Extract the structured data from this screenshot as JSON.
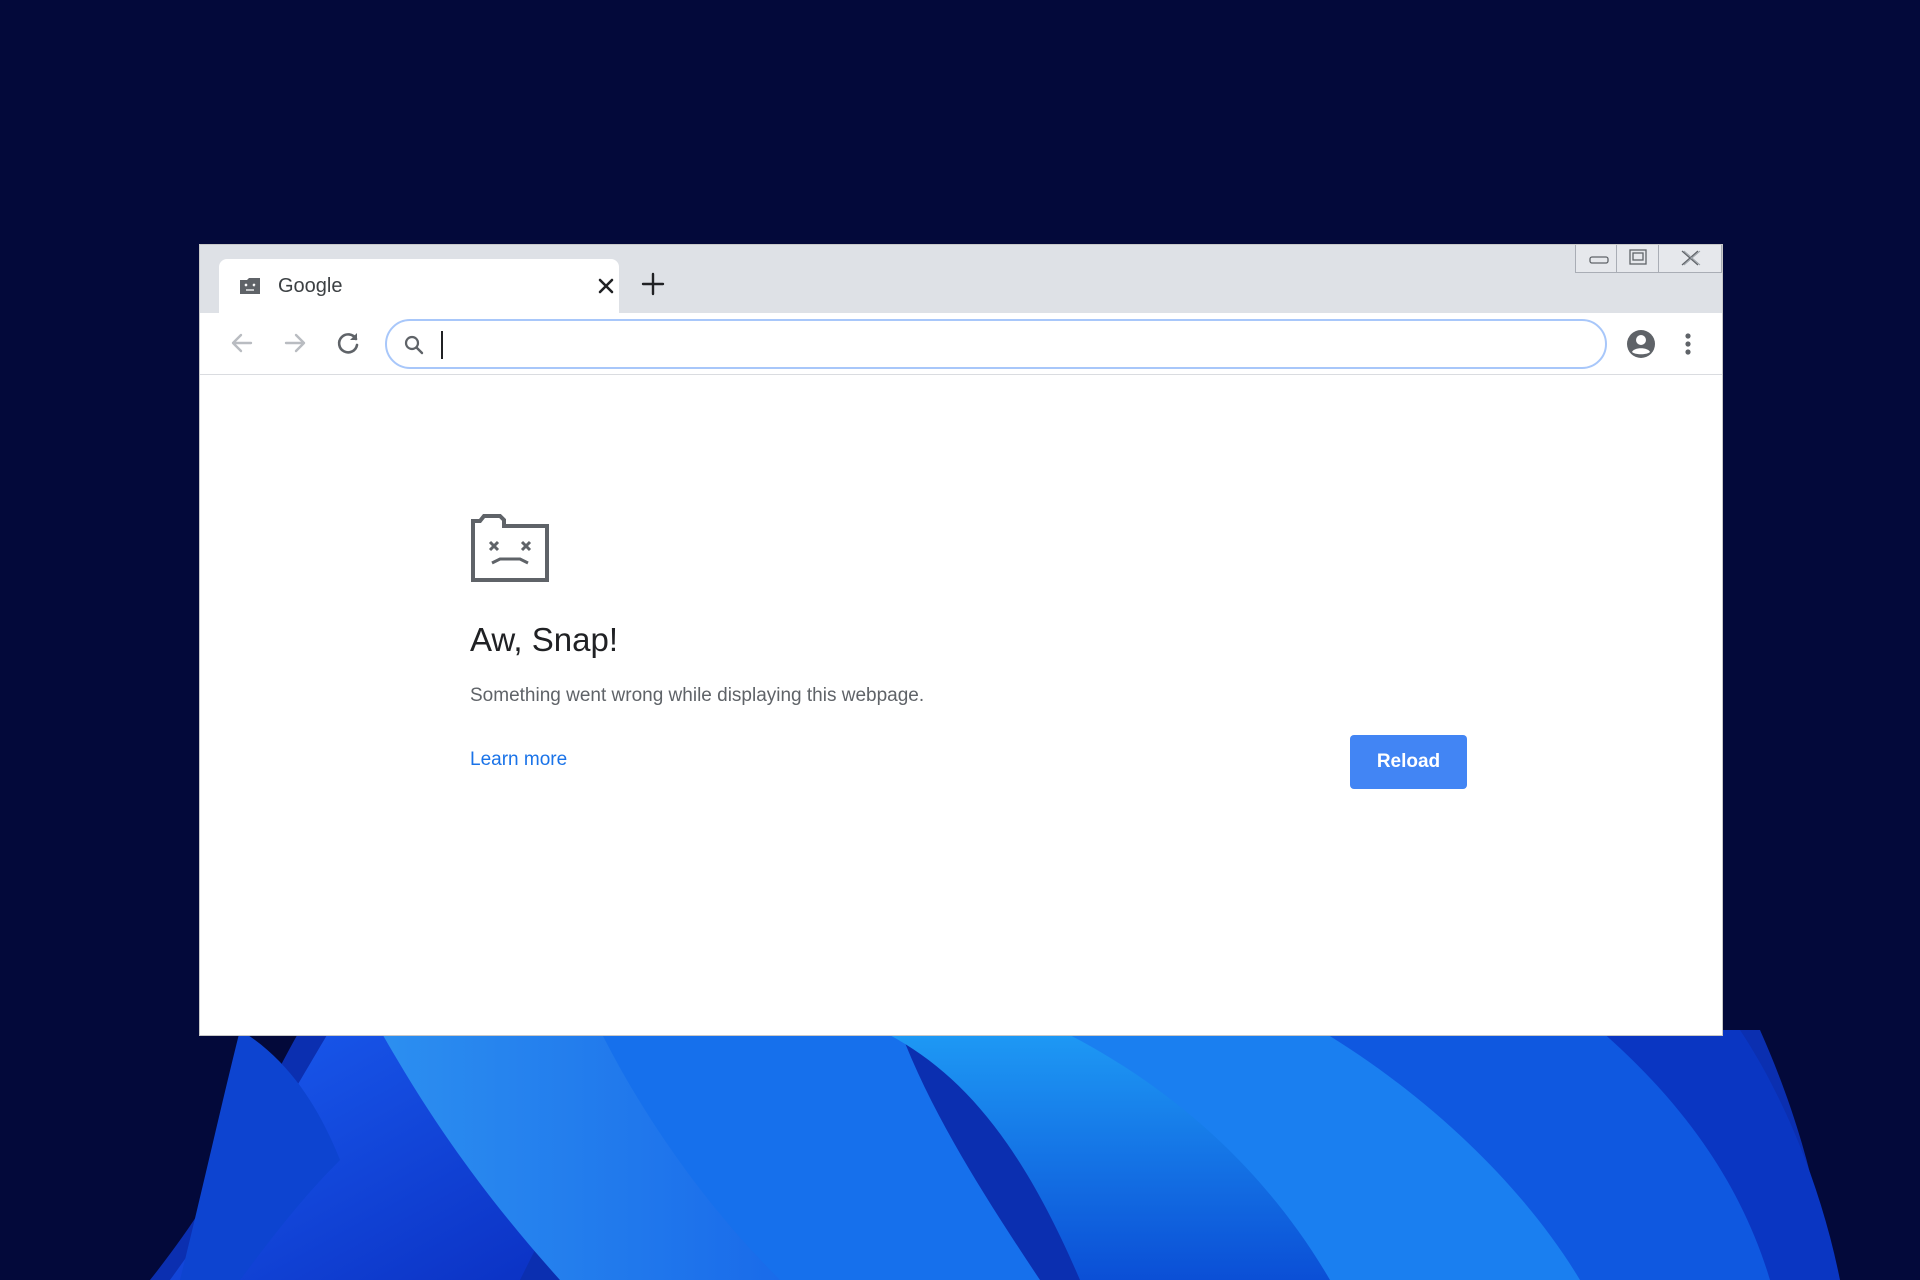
{
  "browser": {
    "tab": {
      "title": "Google",
      "favicon": "sad-folder-icon"
    },
    "omnibox": {
      "value": "",
      "placeholder": ""
    },
    "icons": {
      "back": "arrow-left-icon",
      "forward": "arrow-right-icon",
      "reload": "reload-icon",
      "search": "search-icon",
      "account": "account-circle-icon",
      "menu": "kebab-menu-icon",
      "new_tab": "plus-icon",
      "tab_close": "close-icon"
    }
  },
  "error_page": {
    "icon": "sad-tab-icon",
    "heading": "Aw, Snap!",
    "message": "Something went wrong while displaying this webpage.",
    "learn_more": "Learn more",
    "reload_label": "Reload"
  },
  "colors": {
    "desktop_background": "#03093a",
    "titlebar": "#dee1e6",
    "omnibox_focus_ring": "#a8c7fa",
    "reload_button": "#4285f4",
    "link": "#1a73e8"
  }
}
